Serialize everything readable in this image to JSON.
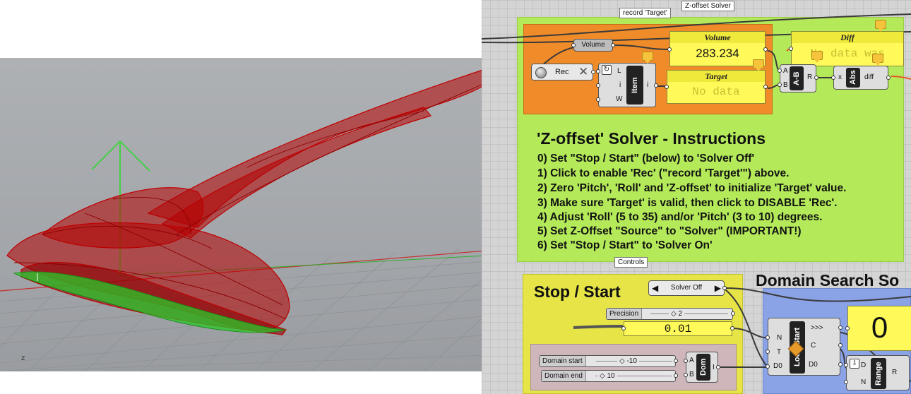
{
  "viewport": {
    "axis_z": "z",
    "colors": {
      "mesh": "#c00000",
      "hull_fill": "#b30000",
      "waterline": "#22cc22",
      "grid": "#8f9296"
    }
  },
  "canvas": {
    "tags": {
      "record_target": "record 'Target'",
      "z_offset_solver": "Z-offset Solver",
      "controls": "Controls"
    },
    "record_group": {
      "volume_param": "Volume",
      "volume_panel": {
        "header": "Volume",
        "value": "283.234"
      },
      "rec_button": {
        "label": "Rec",
        "icon": "close-icon"
      },
      "item": {
        "name": "Item",
        "inputs": [
          "L",
          "i",
          "W"
        ],
        "output": "i"
      },
      "target_panel": {
        "header": "Target",
        "value": "No data"
      }
    },
    "diff_group": {
      "subtract": {
        "name": "A-B",
        "inputs": [
          "A",
          "B"
        ],
        "output": "R"
      },
      "abs": {
        "name": "Abs",
        "input": "x",
        "output": "diff"
      },
      "diff_panel": {
        "header": "Diff",
        "value": "No data was"
      }
    },
    "instructions": {
      "title": "'Z-offset' Solver - Instructions",
      "steps": [
        "0) Set \"Stop / Start\" (below) to 'Solver Off'",
        "1) Click to enable 'Rec' (\"record 'Target'\") above.",
        "2) Zero 'Pitch', 'Roll' and 'Z-offset' to initialize 'Target' value.",
        "3) Make sure 'Target' is valid, then click to DISABLE 'Rec'.",
        "4) Adjust 'Roll' (5 to 35) and/or 'Pitch' (3 to 10) degrees.",
        "5) Set Z-Offset \"Source\" to \"Solver\" (IMPORTANT!)",
        "6) Set \"Stop / Start\" to 'Solver On'"
      ]
    },
    "controls": {
      "title": "Stop / Start",
      "value_list": {
        "selected": "Solver Off"
      },
      "precision": {
        "label": "Precision",
        "value": "2"
      },
      "precision_panel": {
        "value": "0.01"
      },
      "domain_start": {
        "label": "Domain start",
        "value": "-10"
      },
      "domain_end": {
        "label": "Domain end",
        "value": "10"
      },
      "dom": {
        "name": "Dom",
        "inputs": [
          "A",
          "B"
        ],
        "output": "I"
      }
    },
    "domain_search": {
      "title": "Domain Search So",
      "loop_start": {
        "name": "Loop Start",
        "inputs": [
          "N",
          "T",
          "D0"
        ],
        "outputs": [
          ">>>",
          "C",
          "D0"
        ]
      },
      "result_panel": {
        "value": "0"
      },
      "range": {
        "name": "Range",
        "inputs": [
          "D",
          "N"
        ],
        "output": "R"
      }
    }
  }
}
